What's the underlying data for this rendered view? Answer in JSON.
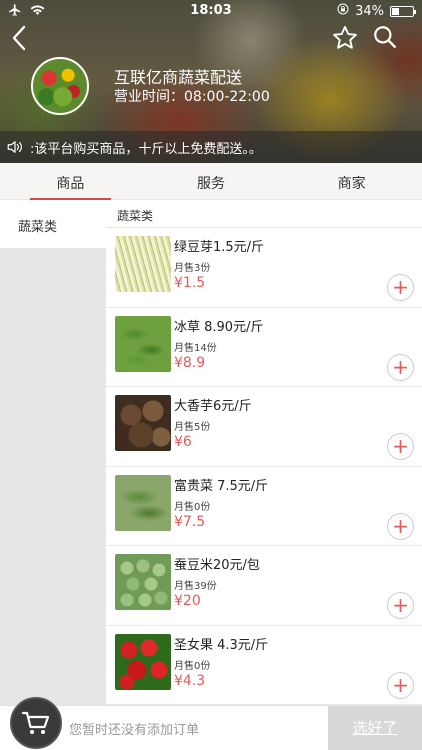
{
  "statusbar": {
    "time": "18:03",
    "battery": "34%",
    "battery_level": 0.34
  },
  "shop": {
    "name": "互联亿商蔬菜配送",
    "hours": "营业时间：08:00-22:00",
    "notice": ":该平台购买商品，十斤以上免费配送。。"
  },
  "tabs": [
    {
      "label": "商品",
      "active": true
    },
    {
      "label": "服务",
      "active": false
    },
    {
      "label": "商家",
      "active": false
    }
  ],
  "categories": [
    {
      "label": "蔬菜类",
      "selected": true
    }
  ],
  "list": {
    "section_title": "蔬菜类",
    "products": [
      {
        "name": "绿豆芽1.5元/斤",
        "sold": "月售3份",
        "price": "¥1.5"
      },
      {
        "name": "冰草  8.90元/斤",
        "sold": "月售14份",
        "price": "¥8.9"
      },
      {
        "name": "大香芋6元/斤",
        "sold": "月售5份",
        "price": "¥6"
      },
      {
        "name": "富贵菜 7.5元/斤",
        "sold": "月售0份",
        "price": "¥7.5"
      },
      {
        "name": "蚕豆米20元/包",
        "sold": "月售39份",
        "price": "¥20"
      },
      {
        "name": "圣女果 4.3元/斤",
        "sold": "月售0份",
        "price": "¥4.3"
      }
    ],
    "add_label": "+"
  },
  "cart": {
    "empty_text": "您暂时还没有添加订单",
    "checkout_label": "选好了"
  },
  "colors": {
    "accent": "#d14b4b",
    "price": "#e35a5a",
    "checkout_disabled": "#d8d8d8"
  },
  "icons": [
    "airplane-icon",
    "wifi-icon",
    "rotation-lock-icon",
    "battery-icon",
    "back-icon",
    "star-icon",
    "search-icon",
    "speaker-icon",
    "cart-icon",
    "plus-icon"
  ]
}
